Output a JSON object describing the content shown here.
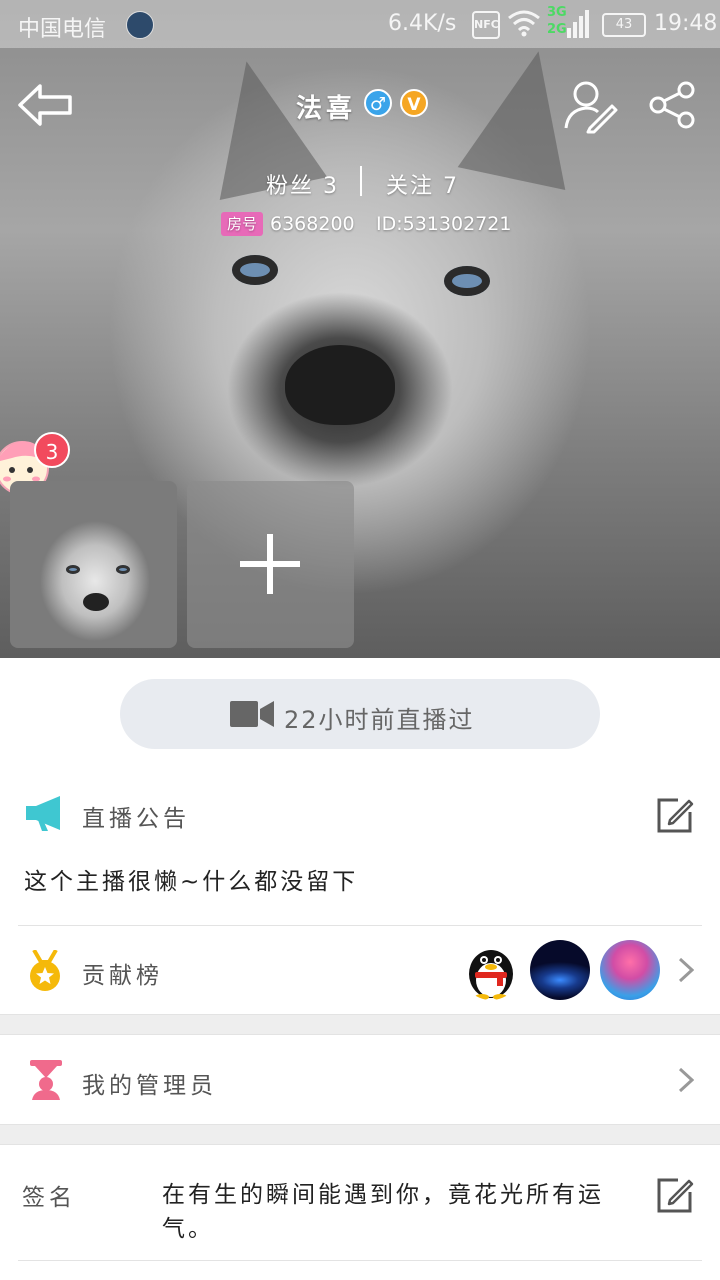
{
  "status_bar": {
    "carrier": "中国电信",
    "net_speed": "6.4K/s",
    "nfc": "NFC",
    "network_top": "3G",
    "network_bottom": "2G",
    "battery": "43",
    "time": "19:48"
  },
  "profile": {
    "username": "法喜",
    "gender_symbol": "♂",
    "vip_symbol": "V",
    "fans_label": "粉丝 3",
    "following_label": "关注 7",
    "room_badge": "房号",
    "room_number": "6368200",
    "user_id": "ID:531302721",
    "mascot_badge_count": "3"
  },
  "live": {
    "last_live": "22小时前直播过"
  },
  "announcement": {
    "title": "直播公告",
    "text": "这个主播很懒~什么都没留下"
  },
  "contribution": {
    "title": "贡献榜"
  },
  "admins": {
    "title": "我的管理员"
  },
  "signature": {
    "label": "签名",
    "text": "在有生的瞬间能遇到你，竟花光所有运气。"
  },
  "colors": {
    "accent_teal": "#3fc7d1",
    "medal_gold": "#f5b90a",
    "admin_pink": "#f06a8c",
    "room_badge_pink": "#e76ab8",
    "gender_blue": "#3aa4ea",
    "vip_orange": "#f5a623",
    "badge_red": "#f24a5d"
  }
}
